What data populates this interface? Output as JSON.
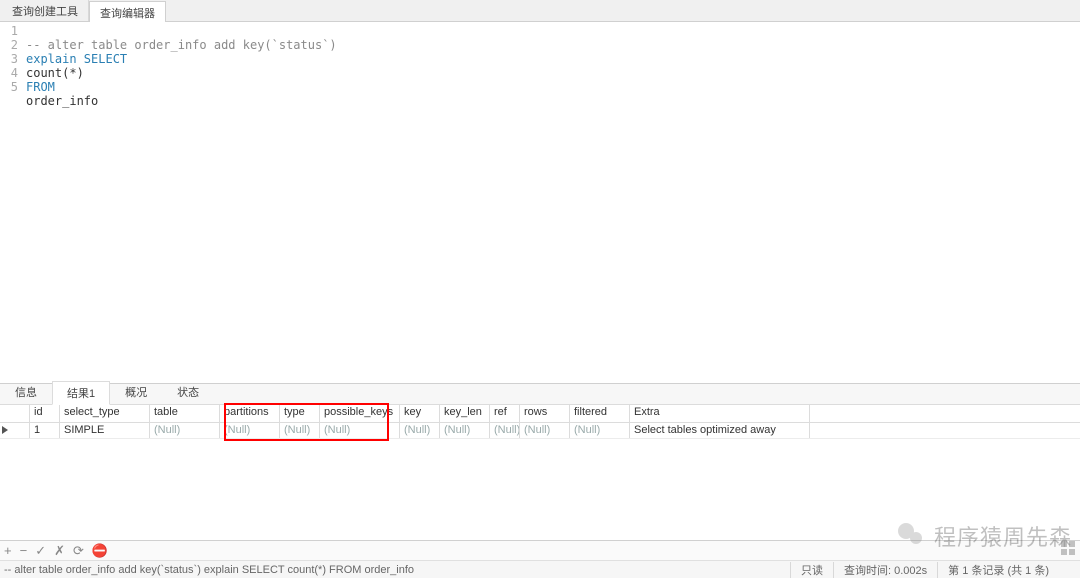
{
  "top_tabs": {
    "inactive": "查询创建工具",
    "active": "查询编辑器"
  },
  "editor": {
    "lines": [
      {
        "n": 1,
        "cls": "c-comment",
        "text": "-- alter table order_info add key(`status`)"
      },
      {
        "n": 2,
        "cls": "c-keyword",
        "text": "explain SELECT"
      },
      {
        "n": 3,
        "cls": "c-plain",
        "text": "count(*)"
      },
      {
        "n": 4,
        "cls": "c-keyword",
        "text": "FROM"
      },
      {
        "n": 5,
        "cls": "c-plain",
        "text": "order_info"
      }
    ]
  },
  "result_tabs": [
    "信息",
    "结果1",
    "概况",
    "状态"
  ],
  "result_tab_active": 1,
  "grid": {
    "columns": [
      "id",
      "select_type",
      "table",
      "partitions",
      "type",
      "possible_keys",
      "key",
      "key_len",
      "ref",
      "rows",
      "filtered",
      "Extra"
    ],
    "row": {
      "id": "1",
      "select_type": "SIMPLE",
      "table": "(Null)",
      "partitions": "(Null)",
      "type": "(Null)",
      "possible_keys": "(Null)",
      "key": "(Null)",
      "key_len": "(Null)",
      "ref": "(Null)",
      "rows": "(Null)",
      "filtered": "(Null)",
      "Extra": "Select tables optimized away"
    }
  },
  "toolbar": {
    "add": "+",
    "minus": "−",
    "check": "✓",
    "cross": "✗",
    "refresh": "⟳",
    "stop": "⛔"
  },
  "status": {
    "sql": "-- alter table order_info add key(`status`) explain SELECT count(*) FROM order_info",
    "readonly": "只读",
    "qtime": "查询时间: 0.002s",
    "records": "第 1 条记录 (共 1 条)"
  },
  "watermark": "程序猿周先森"
}
